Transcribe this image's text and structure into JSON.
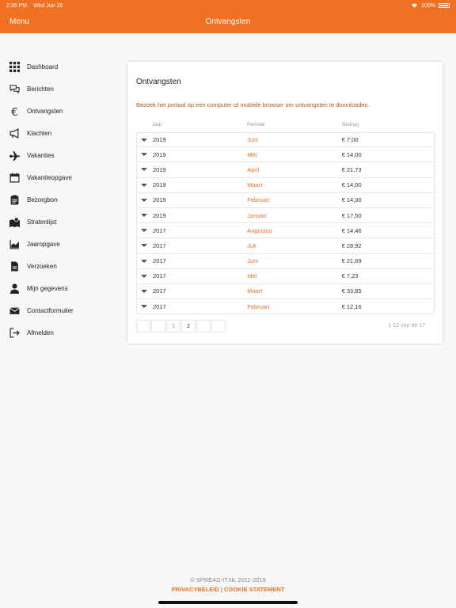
{
  "status": {
    "time": "2:35 PM",
    "date": "Wed Jun 26",
    "battery": "100%"
  },
  "navbar": {
    "menu_label": "Menu",
    "title": "Ontvangsten"
  },
  "sidebar": {
    "items": [
      {
        "label": "Dashboard",
        "icon": "grid-icon"
      },
      {
        "label": "Berichten",
        "icon": "chat-icon"
      },
      {
        "label": "Ontvangsten",
        "icon": "euro-icon"
      },
      {
        "label": "Klachten",
        "icon": "megaphone-icon"
      },
      {
        "label": "Vakanties",
        "icon": "plane-icon"
      },
      {
        "label": "Vakantieopgave",
        "icon": "calendar-icon"
      },
      {
        "label": "Bezorgbon",
        "icon": "clipboard-icon"
      },
      {
        "label": "Stratenlijst",
        "icon": "map-icon"
      },
      {
        "label": "Jaaropgave",
        "icon": "area-chart-icon"
      },
      {
        "label": "Verzoeken",
        "icon": "document-icon"
      },
      {
        "label": "Mijn gegevens",
        "icon": "user-icon"
      },
      {
        "label": "Contactformulier",
        "icon": "envelope-icon"
      },
      {
        "label": "Afmelden",
        "icon": "logout-icon"
      }
    ]
  },
  "card": {
    "title": "Ontvangsten",
    "message": "Bezoek het portaal op een computer of mobiele browser om ontvangsten te downloaden.",
    "columns": {
      "year": "Jaar",
      "period": "Periode",
      "amount": "Bedrag"
    },
    "rows": [
      {
        "year": "2019",
        "period": "Juni",
        "amount": "€ 7,00"
      },
      {
        "year": "2019",
        "period": "Mei",
        "amount": "€ 14,00"
      },
      {
        "year": "2019",
        "period": "April",
        "amount": "€ 21,73"
      },
      {
        "year": "2019",
        "period": "Maart",
        "amount": "€ 14,00"
      },
      {
        "year": "2019",
        "period": "Februari",
        "amount": "€ 14,00"
      },
      {
        "year": "2019",
        "period": "Januari",
        "amount": "€ 17,50"
      },
      {
        "year": "2017",
        "period": "Augustus",
        "amount": "€ 14,46"
      },
      {
        "year": "2017",
        "period": "Juli",
        "amount": "€ 28,92"
      },
      {
        "year": "2017",
        "period": "Juni",
        "amount": "€ 21,69"
      },
      {
        "year": "2017",
        "period": "Mei",
        "amount": "€ 7,23"
      },
      {
        "year": "2017",
        "period": "Maart",
        "amount": "€ 33,85"
      },
      {
        "year": "2017",
        "period": "Februari",
        "amount": "€ 12,16"
      }
    ],
    "pagination": {
      "page1": "1",
      "page2": "2",
      "count_text": "1-12 van de 17"
    }
  },
  "footer": {
    "copyright": "© SPREAD-IT.NL 2011-2019",
    "privacy": "PRIVACYBELEID",
    "separator": "|",
    "cookie": "COOKIE STATEMENT"
  },
  "colors": {
    "accent": "#ee7124"
  }
}
